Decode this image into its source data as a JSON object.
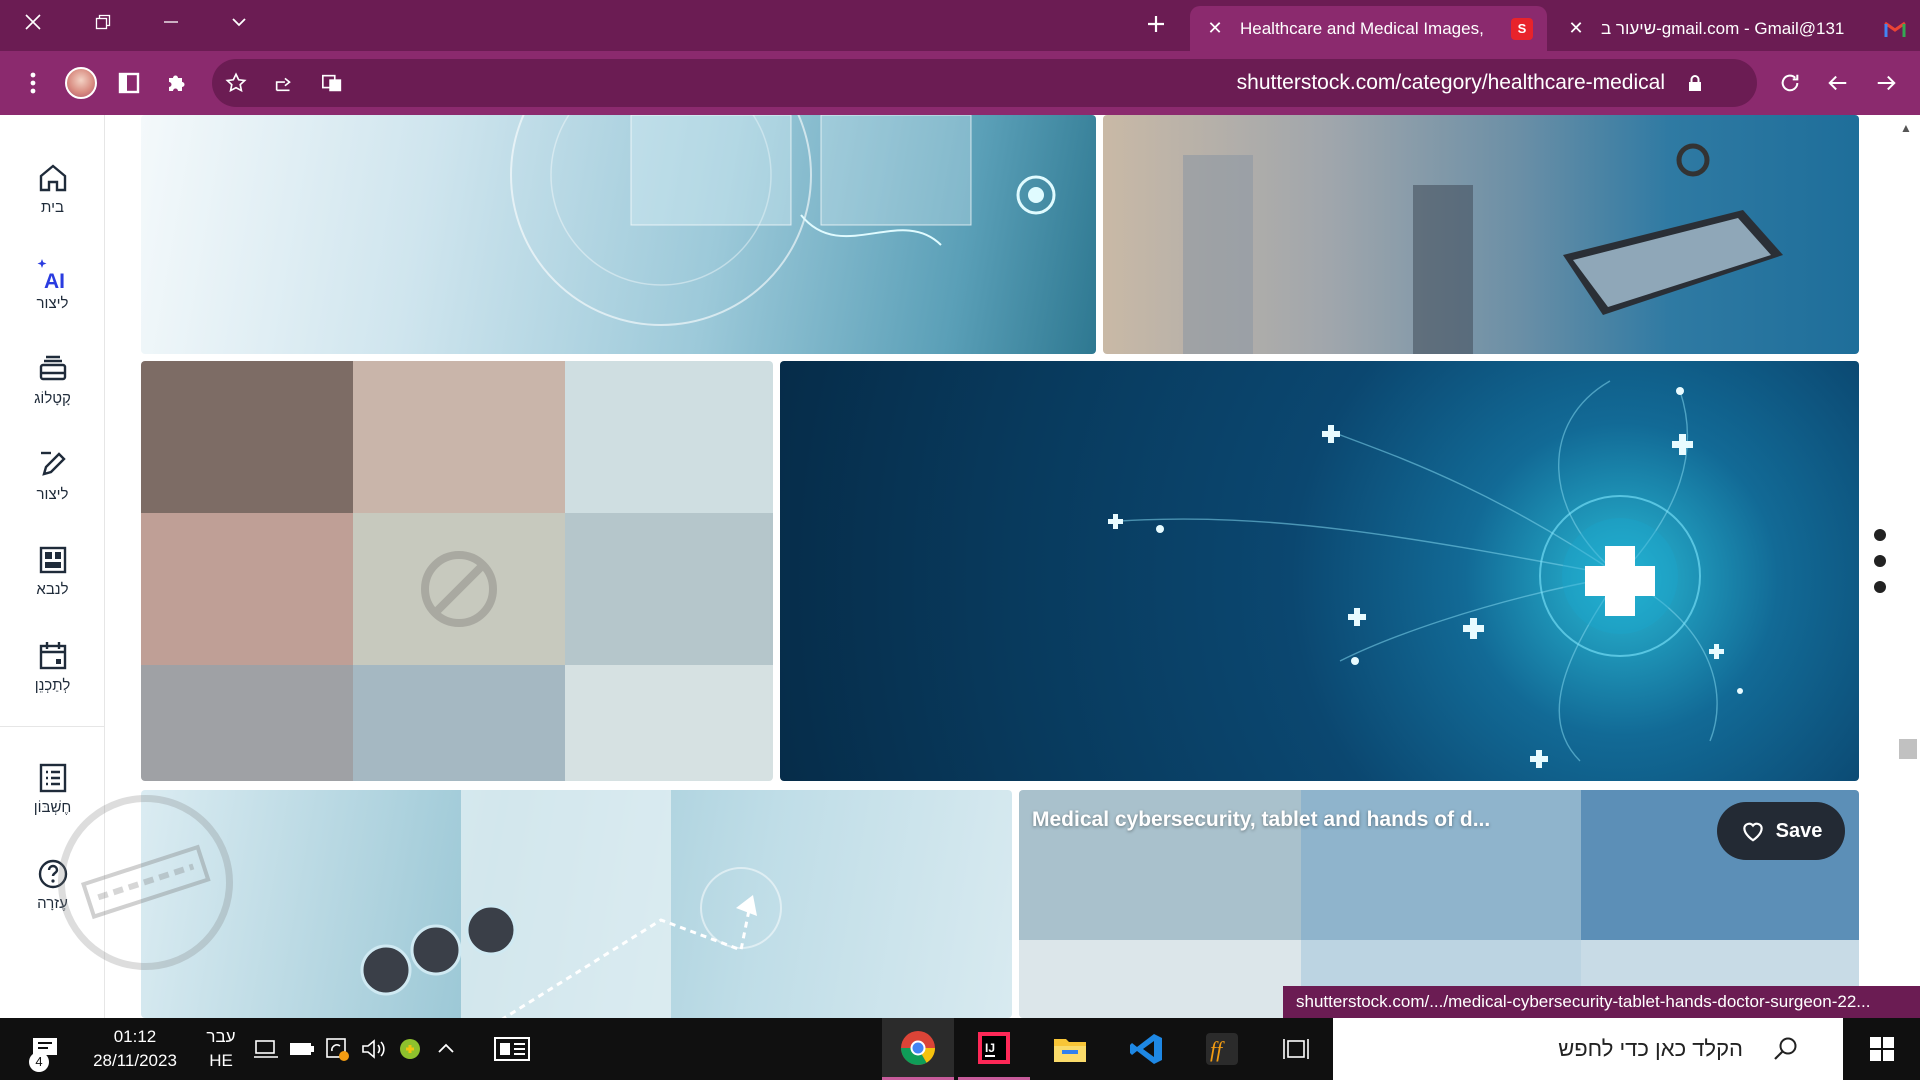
{
  "tabs": [
    {
      "title": "Healthcare and Medical Images,",
      "active": true,
      "favicon": "shutterstock-icon"
    },
    {
      "title": "131@gmail.com - Gmail-שיעור ב",
      "active": false,
      "favicon": "gmail-icon"
    }
  ],
  "toolbar": {
    "url": "shutterstock.com/category/healthcare-medical"
  },
  "sidebar": {
    "items": [
      {
        "label": "בית",
        "icon": "home-icon"
      },
      {
        "label": "ליצור",
        "icon": "ai-sparkle-icon"
      },
      {
        "label": "קָטָלוֹג",
        "icon": "catalog-icon"
      },
      {
        "label": "ליצור",
        "icon": "edit-icon"
      },
      {
        "label": "לנבא",
        "icon": "layout-icon"
      },
      {
        "label": "לְתַכְנֵן",
        "icon": "calendar-icon"
      },
      {
        "label": "חֶשְׁבּוֹן",
        "icon": "account-list-icon"
      },
      {
        "label": "עֶזרָה",
        "icon": "help-icon"
      }
    ]
  },
  "gallery": {
    "hover_caption": "Medical cybersecurity, tablet and hands of d...",
    "save_label": "Save",
    "placeholder_colors": [
      "#7d6c65",
      "#c9b5aa",
      "#cfdee1",
      "#bf9f96",
      "#c7c9be",
      "#b5c6cb",
      "#9fa1a5",
      "#a5b8c2",
      "#d6e1e2"
    ],
    "hover_colors": [
      "#a9c1cc",
      "#8fb4cc",
      "#5c8fb7",
      "#dce6ea",
      "#bcd4e2",
      "#c8dbe6"
    ]
  },
  "status_url": "shutterstock.com/.../medical-cybersecurity-tablet-hands-doctor-surgeon-22...",
  "taskbar": {
    "search_placeholder": "הקלד כאן כדי לחפש",
    "notification_count": "4",
    "time": "01:12",
    "date": "28/11/2023",
    "lang_top": "עבר",
    "lang_bottom": "HE"
  }
}
